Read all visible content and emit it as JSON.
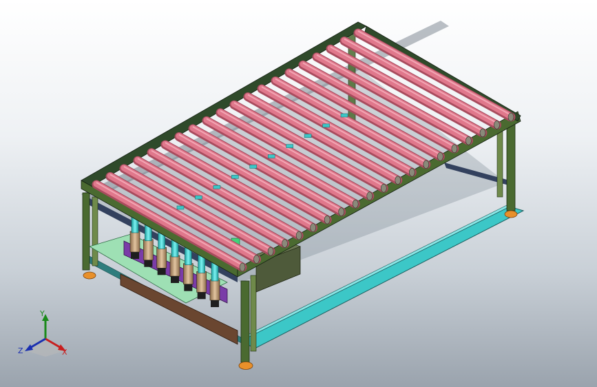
{
  "viewport": {
    "background_top": "#ffffff",
    "background_bottom": "#9aa3ad"
  },
  "model": {
    "roller_count": 20,
    "colors": {
      "roller": "#e0788c",
      "roller_highlight": "#f2a6b4",
      "roller_shadow": "#a84c5e",
      "frame": "#2f4a2a",
      "frame_light": "#6f8a4a",
      "leg": "#4a6a30",
      "foot": "#e8902a",
      "base_rail": "#3cc7c7",
      "cylinder": "#3fd4d4",
      "cylinder_body": "#c9a27a",
      "purple_bracket": "#7a3ca8",
      "motor_box": "#4e5a3a",
      "brown_rail": "#6a4630"
    }
  },
  "triad": {
    "y_label": "Y",
    "z_label": "Z",
    "x_label": "X",
    "colors": {
      "x": "#c81e1e",
      "y": "#1a8a1a",
      "z": "#1a2fb0"
    }
  }
}
